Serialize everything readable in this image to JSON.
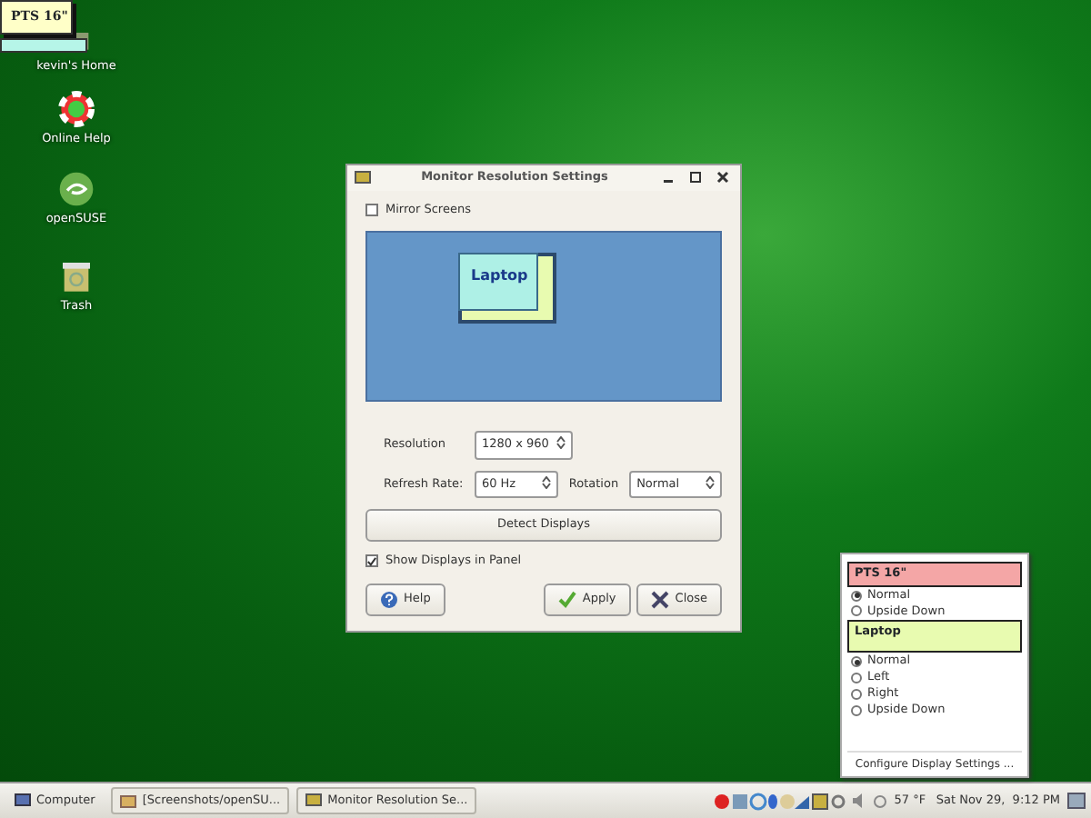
{
  "corner_label": {
    "text": "PTS 16\""
  },
  "desktop_icons": [
    {
      "label": "kevin's Home",
      "kind": "home"
    },
    {
      "label": "Online Help",
      "kind": "help"
    },
    {
      "label": "openSUSE",
      "kind": "suse"
    },
    {
      "label": "Trash",
      "kind": "trash"
    }
  ],
  "dialog": {
    "title": "Monitor Resolution Settings",
    "mirror_screens": {
      "label": "Mirror Screens",
      "checked": false
    },
    "monitor_preview": {
      "label": "Laptop"
    },
    "resolution": {
      "label": "Resolution",
      "value": "1280 x 960"
    },
    "refresh_rate": {
      "label": "Refresh Rate:",
      "value": "60 Hz"
    },
    "rotation": {
      "label": "Rotation",
      "value": "Normal"
    },
    "detect_button": "Detect Displays",
    "show_in_panel": {
      "label": "Show Displays in Panel",
      "checked": true
    },
    "buttons": [
      {
        "label": "Help",
        "kind": "help"
      },
      {
        "label": "Apply",
        "kind": "apply"
      },
      {
        "label": "Close",
        "kind": "close"
      }
    ]
  },
  "popup_menu": {
    "displays": [
      {
        "name": "PTS 16\"",
        "color": "#f4a6a6",
        "options": [
          {
            "label": "Normal",
            "selected": true
          },
          {
            "label": "Upside Down",
            "selected": false
          }
        ]
      },
      {
        "name": "Laptop",
        "color": "#e8fbb0",
        "options": [
          {
            "label": "Normal",
            "selected": true
          },
          {
            "label": "Left",
            "selected": false
          },
          {
            "label": "Right",
            "selected": false
          },
          {
            "label": "Upside Down",
            "selected": false
          }
        ]
      }
    ],
    "configure": "Configure Display Settings ..."
  },
  "taskbar": {
    "items": [
      {
        "label": "Computer",
        "kind": "computer"
      },
      {
        "label": "[Screenshots/openSU...",
        "kind": "folder"
      },
      {
        "label": "Monitor Resolution Se...",
        "kind": "display"
      }
    ],
    "weather": "57 °F",
    "clock": "Sat Nov 29,  9:12 PM"
  }
}
